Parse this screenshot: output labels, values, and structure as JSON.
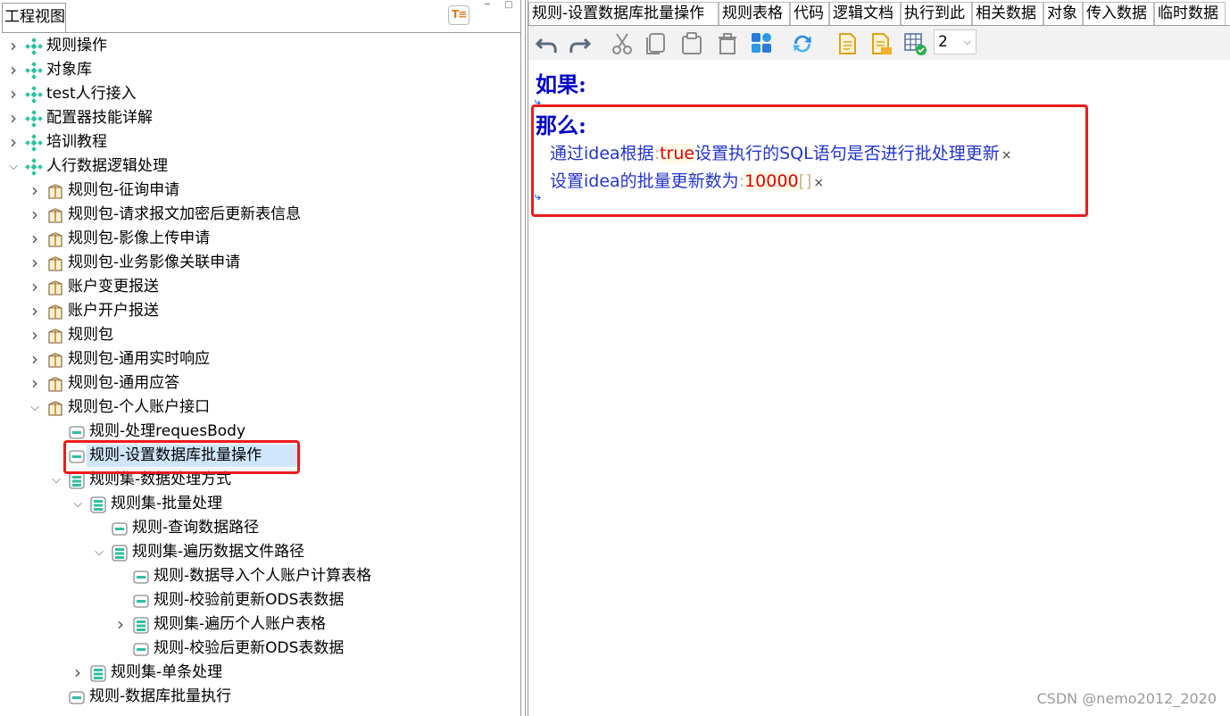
{
  "left_panel": {
    "tab_title": "工程视图",
    "collapse_glyph": "T≡"
  },
  "tree": {
    "items": [
      {
        "label": "规则操作",
        "icon": "diamond-icon",
        "level": 0,
        "expander": "collapsed"
      },
      {
        "label": "对象库",
        "icon": "diamond-icon",
        "level": 0,
        "expander": "collapsed"
      },
      {
        "label": "test人行接入",
        "icon": "diamond-icon",
        "level": 0,
        "expander": "collapsed"
      },
      {
        "label": "配置器技能详解",
        "icon": "diamond-icon",
        "level": 0,
        "expander": "collapsed"
      },
      {
        "label": "培训教程",
        "icon": "diamond-icon",
        "level": 0,
        "expander": "collapsed"
      },
      {
        "label": "人行数据逻辑处理",
        "icon": "diamond-icon",
        "level": 0,
        "expander": "expanded"
      },
      {
        "label": "规则包-征询申请",
        "icon": "package-icon",
        "level": 1,
        "expander": "collapsed"
      },
      {
        "label": "规则包-请求报文加密后更新表信息",
        "icon": "package-icon",
        "level": 1,
        "expander": "collapsed"
      },
      {
        "label": "规则包-影像上传申请",
        "icon": "package-icon",
        "level": 1,
        "expander": "collapsed"
      },
      {
        "label": "规则包-业务影像关联申请",
        "icon": "package-icon",
        "level": 1,
        "expander": "collapsed"
      },
      {
        "label": "账户变更报送",
        "icon": "package-icon",
        "level": 1,
        "expander": "collapsed"
      },
      {
        "label": "账户开户报送",
        "icon": "package-icon",
        "level": 1,
        "expander": "collapsed"
      },
      {
        "label": "规则包",
        "icon": "package-icon",
        "level": 1,
        "expander": "collapsed"
      },
      {
        "label": "规则包-通用实时响应",
        "icon": "package-icon",
        "level": 1,
        "expander": "collapsed"
      },
      {
        "label": "规则包-通用应答",
        "icon": "package-icon",
        "level": 1,
        "expander": "collapsed"
      },
      {
        "label": "规则包-个人账户接口",
        "icon": "package-icon",
        "level": 1,
        "expander": "expanded"
      },
      {
        "label": "规则-处理requesBody",
        "icon": "rule-icon",
        "level": 2,
        "expander": "none"
      },
      {
        "label": "规则-设置数据库批量操作",
        "icon": "rule-icon",
        "level": 2,
        "expander": "none",
        "selected": true
      },
      {
        "label": "规则集-数据处理方式",
        "icon": "ruleset-icon",
        "level": 2,
        "expander": "expanded"
      },
      {
        "label": "规则集-批量处理",
        "icon": "ruleset-icon",
        "level": 3,
        "expander": "expanded"
      },
      {
        "label": "规则-查询数据路径",
        "icon": "rule-icon",
        "level": 4,
        "expander": "none"
      },
      {
        "label": "规则集-遍历数据文件路径",
        "icon": "ruleset-icon",
        "level": 4,
        "expander": "expanded"
      },
      {
        "label": "规则-数据导入个人账户计算表格",
        "icon": "rule-icon",
        "level": 5,
        "expander": "none"
      },
      {
        "label": "规则-校验前更新ODS表数据",
        "icon": "rule-icon",
        "level": 5,
        "expander": "none"
      },
      {
        "label": "规则集-遍历个人账户表格",
        "icon": "ruleset-icon",
        "level": 5,
        "expander": "collapsed"
      },
      {
        "label": "规则-校验后更新ODS表数据",
        "icon": "rule-icon",
        "level": 5,
        "expander": "none"
      },
      {
        "label": "规则集-单条处理",
        "icon": "ruleset-icon",
        "level": 3,
        "expander": "collapsed"
      },
      {
        "label": "规则-数据库批量执行",
        "icon": "rule-icon",
        "level": 2,
        "expander": "none"
      }
    ]
  },
  "tabs": [
    {
      "label": "规则-设置数据库批量操作",
      "active": true
    },
    {
      "label": "规则表格"
    },
    {
      "label": "代码"
    },
    {
      "label": "逻辑文档"
    },
    {
      "label": "执行到此"
    },
    {
      "label": "相关数据"
    },
    {
      "label": "对象"
    },
    {
      "label": "传入数据"
    },
    {
      "label": "临时数据"
    }
  ],
  "toolbar": {
    "buttons": [
      "undo-icon",
      "redo-icon",
      "cut-icon",
      "copy-icon",
      "paste-icon",
      "delete-icon",
      "grid-icon",
      "refresh-icon",
      "document-icon",
      "document-export-icon",
      "table-check-icon"
    ],
    "zoom_value": "2"
  },
  "editor": {
    "if_keyword": "如果:",
    "then_keyword": "那么:",
    "actions": [
      {
        "pre": "通过idea根据",
        "colon": ":",
        "value": "true",
        "post": "设置执行的SQL语句是否进行批处理更新",
        "remove": "×"
      },
      {
        "pre": "设置idea的批量更新数为",
        "colon": ":",
        "value": "10000",
        "bracket": "[]",
        "remove": "×"
      }
    ]
  },
  "colors": {
    "keyword": "#0000c8",
    "value": "#e30000",
    "highlight_box": "#ec1c1c",
    "selection": "#cfe6fc",
    "icon_teal": "#2cc0a0"
  },
  "watermark": "CSDN @nemo2012_2020"
}
